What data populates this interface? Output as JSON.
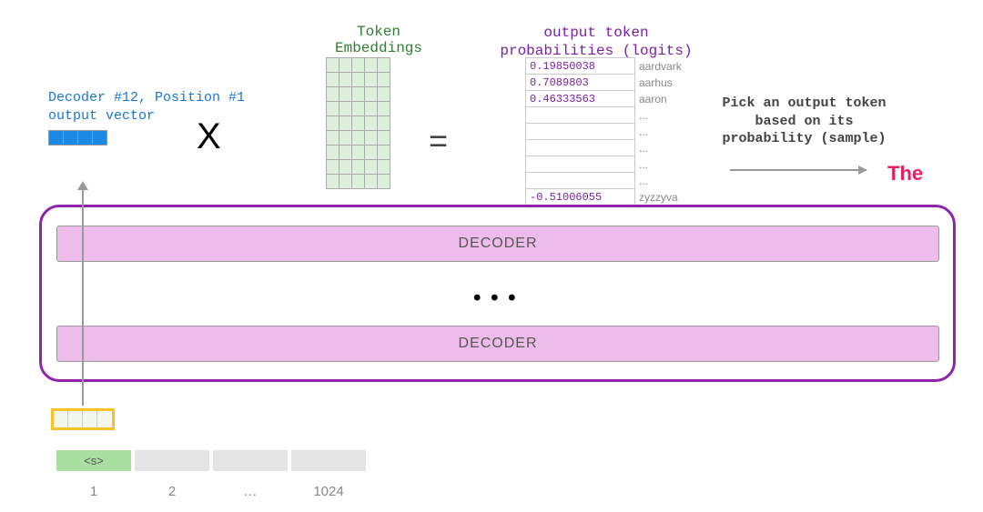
{
  "output_vector_label": "Decoder #12, Position #1\noutput vector",
  "multiply_sign": "X",
  "embeddings_label": "Token\nEmbeddings",
  "equals_sign": "=",
  "logits_label": "output token\nprobabilities (logits)",
  "logits": [
    {
      "value": "0.19850038",
      "word": "aardvark"
    },
    {
      "value": "0.7089803",
      "word": "aarhus"
    },
    {
      "value": "0.46333563",
      "word": "aaron"
    },
    {
      "value": "",
      "word": "..."
    },
    {
      "value": "",
      "word": "..."
    },
    {
      "value": "",
      "word": "..."
    },
    {
      "value": "",
      "word": "..."
    },
    {
      "value": "",
      "word": "..."
    },
    {
      "value": "-0.51006055",
      "word": "zyzzyva"
    }
  ],
  "pick_label": "Pick an output token based on its probability (sample)",
  "sampled_token": "The",
  "decoder_layer_label": "DECODER",
  "decoder_dots": "• • •",
  "input_tokens": [
    "<s>",
    "",
    "",
    ""
  ],
  "positions": [
    "1",
    "2",
    "…",
    "1024"
  ],
  "embedding_matrix": {
    "rows": 9,
    "cols": 5
  },
  "output_vector_cells": 4,
  "input_vector_cells": 4,
  "colors": {
    "blue": "#1e88e5",
    "green_text": "#2e7d32",
    "purple_text": "#7b1fa2",
    "purple_border": "#8e24aa",
    "pink_fill": "#eebcea",
    "magenta": "#e91e63",
    "yellow_border": "#f9c22b",
    "token_green": "#a8e0a0",
    "token_grey": "#e4e4e4"
  }
}
